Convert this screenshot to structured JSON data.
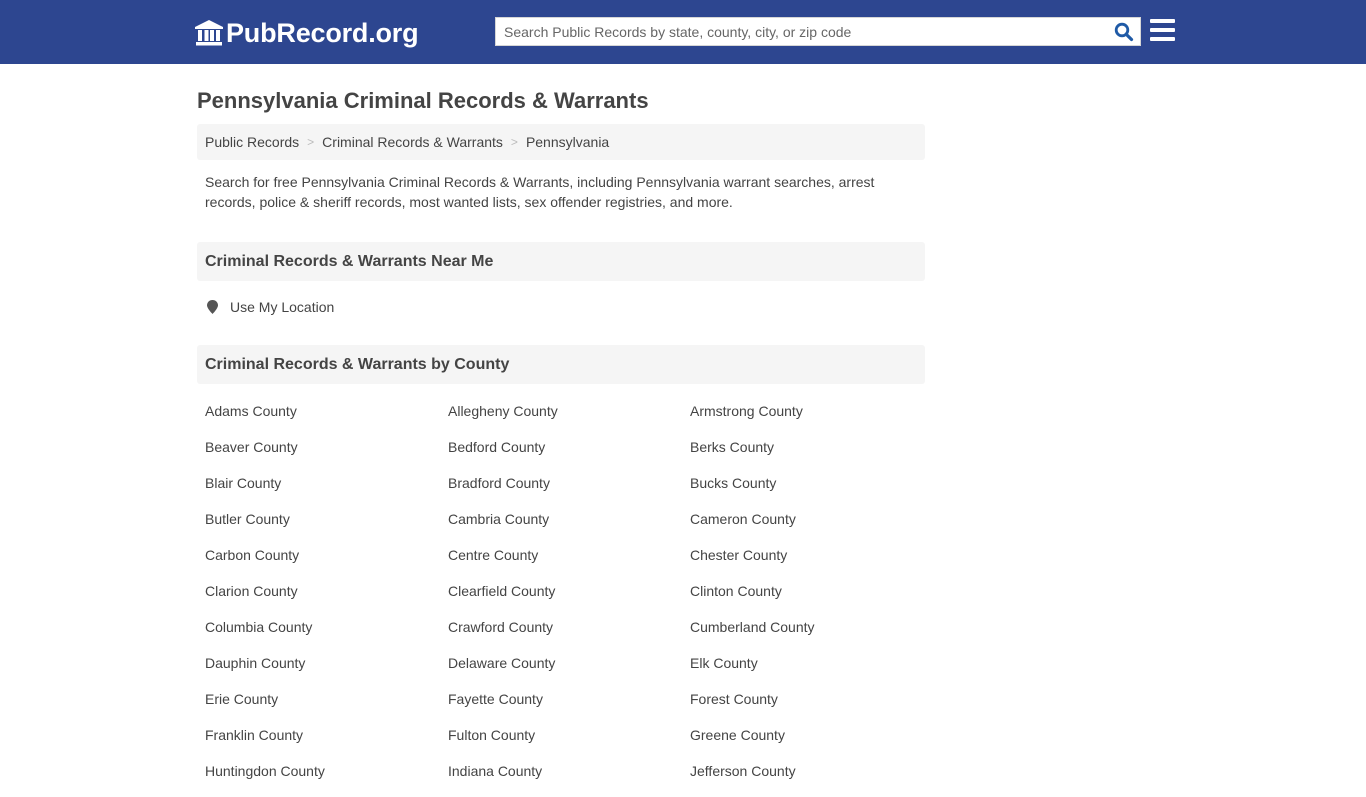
{
  "header": {
    "logo_text": "PubRecord.org",
    "logo_icon": "bank-building-icon",
    "search": {
      "placeholder": "Search Public Records by state, county, city, or zip code",
      "value": "",
      "button_icon": "search-icon"
    },
    "menu_icon": "hamburger-menu-icon",
    "brand_color": "#2d4690"
  },
  "page": {
    "title": "Pennsylvania Criminal Records & Warrants",
    "breadcrumb": [
      {
        "label": "Public Records"
      },
      {
        "label": "Criminal Records & Warrants"
      },
      {
        "label": "Pennsylvania"
      }
    ],
    "breadcrumb_separator": ">",
    "intro": "Search for free Pennsylvania Criminal Records & Warrants, including Pennsylvania warrant searches, arrest records, police & sheriff records, most wanted lists, sex offender registries, and more."
  },
  "near_me": {
    "heading": "Criminal Records & Warrants Near Me",
    "use_location_label": "Use My Location",
    "icon": "map-marker-icon"
  },
  "by_county": {
    "heading": "Criminal Records & Warrants by County",
    "counties": [
      "Adams County",
      "Allegheny County",
      "Armstrong County",
      "Beaver County",
      "Bedford County",
      "Berks County",
      "Blair County",
      "Bradford County",
      "Bucks County",
      "Butler County",
      "Cambria County",
      "Cameron County",
      "Carbon County",
      "Centre County",
      "Chester County",
      "Clarion County",
      "Clearfield County",
      "Clinton County",
      "Columbia County",
      "Crawford County",
      "Cumberland County",
      "Dauphin County",
      "Delaware County",
      "Elk County",
      "Erie County",
      "Fayette County",
      "Forest County",
      "Franklin County",
      "Fulton County",
      "Greene County",
      "Huntingdon County",
      "Indiana County",
      "Jefferson County"
    ]
  }
}
